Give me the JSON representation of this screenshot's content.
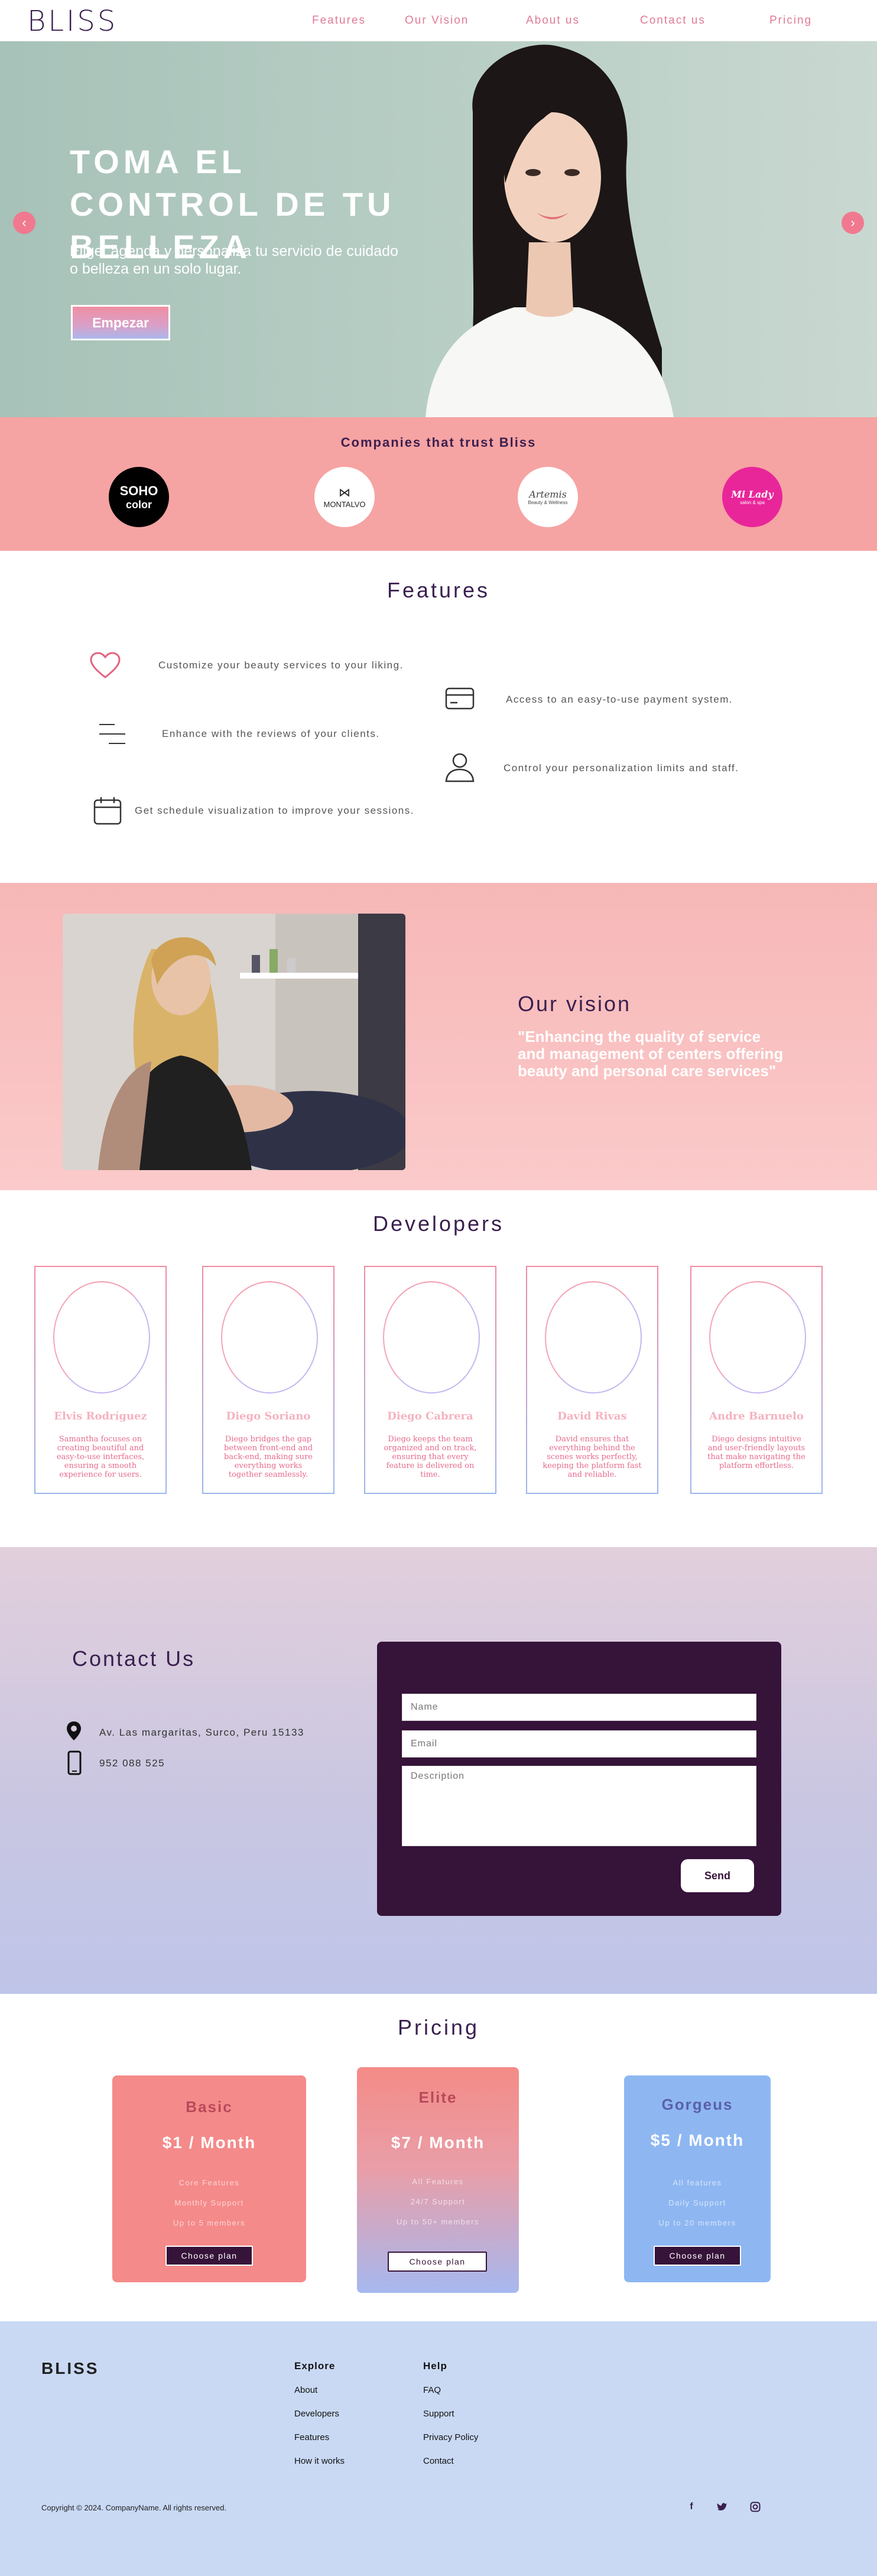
{
  "nav": {
    "logo": "BLISS",
    "links": [
      "Features",
      "Our Vision",
      "About us",
      "Contact us",
      "Pricing"
    ]
  },
  "hero": {
    "title": "TOMA EL CONTROL DE TU BELLEZA",
    "subtitle": "Elige, agenda y personaliza tu servicio de cuidado o belleza en un solo lugar.",
    "button": "Empezar",
    "prev_icon": "chevron-left-icon",
    "next_icon": "chevron-right-icon"
  },
  "companies": {
    "title": "Companies that trust Bliss",
    "logos": [
      {
        "line1": "SOHO",
        "line2": "color"
      },
      {
        "line1": "MONTALVO"
      },
      {
        "line1": "Artemis",
        "line2": "Beauty & Wellness"
      },
      {
        "line1": "Mi Lady",
        "line2": "salon & spa"
      }
    ]
  },
  "features": {
    "title": "Features",
    "items": [
      {
        "icon": "heart-icon",
        "text": "Customize your beauty services to your liking."
      },
      {
        "icon": "credit-card-icon",
        "text": "Access to an easy-to-use payment system."
      },
      {
        "icon": "menu-lines-icon",
        "text": "Enhance with the reviews of your clients."
      },
      {
        "icon": "user-icon",
        "text": "Control your personalization limits and staff."
      },
      {
        "icon": "calendar-icon",
        "text": "Get schedule visualization to improve your sessions."
      }
    ]
  },
  "vision": {
    "title": "Our vision",
    "quote": "\"Enhancing the quality of service and management of centers offering beauty and personal care services\""
  },
  "developers": {
    "title": "Developers",
    "cards": [
      {
        "name": "Elvis Rodríguez",
        "desc": "Samantha focuses on creating beautiful and easy-to-use interfaces, ensuring a smooth experience for users."
      },
      {
        "name": "Diego Soriano",
        "desc": "Diego bridges the gap between front-end and back-end, making sure everything works together seamlessly."
      },
      {
        "name": "Diego Cabrera",
        "desc": "Diego keeps the team organized and on track, ensuring that every feature is delivered on time."
      },
      {
        "name": "David Rivas",
        "desc": "David ensures that everything behind the scenes works perfectly, keeping the platform fast and reliable."
      },
      {
        "name": "Andre Barnuelo",
        "desc": "Diego designs intuitive and user-friendly layouts that make navigating the platform effortless."
      }
    ]
  },
  "contact": {
    "title": "Contact Us",
    "address": "Av. Las margaritas, Surco, Peru 15133",
    "phone": "952 088 525",
    "form": {
      "name_placeholder": "Name",
      "email_placeholder": "Email",
      "description_placeholder": "Description",
      "send": "Send"
    }
  },
  "pricing": {
    "title": "Pricing",
    "plans": [
      {
        "name": "Basic",
        "price": "$1 / Month",
        "features": [
          "Core Features",
          "Monthly Support",
          "Up to 5 members"
        ],
        "button": "Choose plan"
      },
      {
        "name": "Elite",
        "price": "$7 / Month",
        "features": [
          "All Features",
          "24/7 Support",
          "Up to 50+ members"
        ],
        "button": "Choose plan"
      },
      {
        "name": "Gorgeus",
        "price": "$5 / Month",
        "features": [
          "All features",
          "Daily Support",
          "Up to 20 members"
        ],
        "button": "Choose plan"
      }
    ]
  },
  "footer": {
    "logo": "BLISS",
    "explore_title": "Explore",
    "explore_links": [
      "About",
      "Developers",
      "Features",
      "How it works"
    ],
    "help_title": "Help",
    "help_links": [
      "FAQ",
      "Support",
      "Privacy Policy",
      "Contact"
    ],
    "copyright": "Copyright © 2024. CompanyName. All rights reserved.",
    "social": [
      "facebook-icon",
      "twitter-icon",
      "instagram-icon"
    ]
  },
  "colors": {
    "brand_dark": "#361339",
    "accent_pink": "#f6a3a3",
    "nav_link": "#e07a95",
    "footer_bg": "#c9d9f4"
  }
}
